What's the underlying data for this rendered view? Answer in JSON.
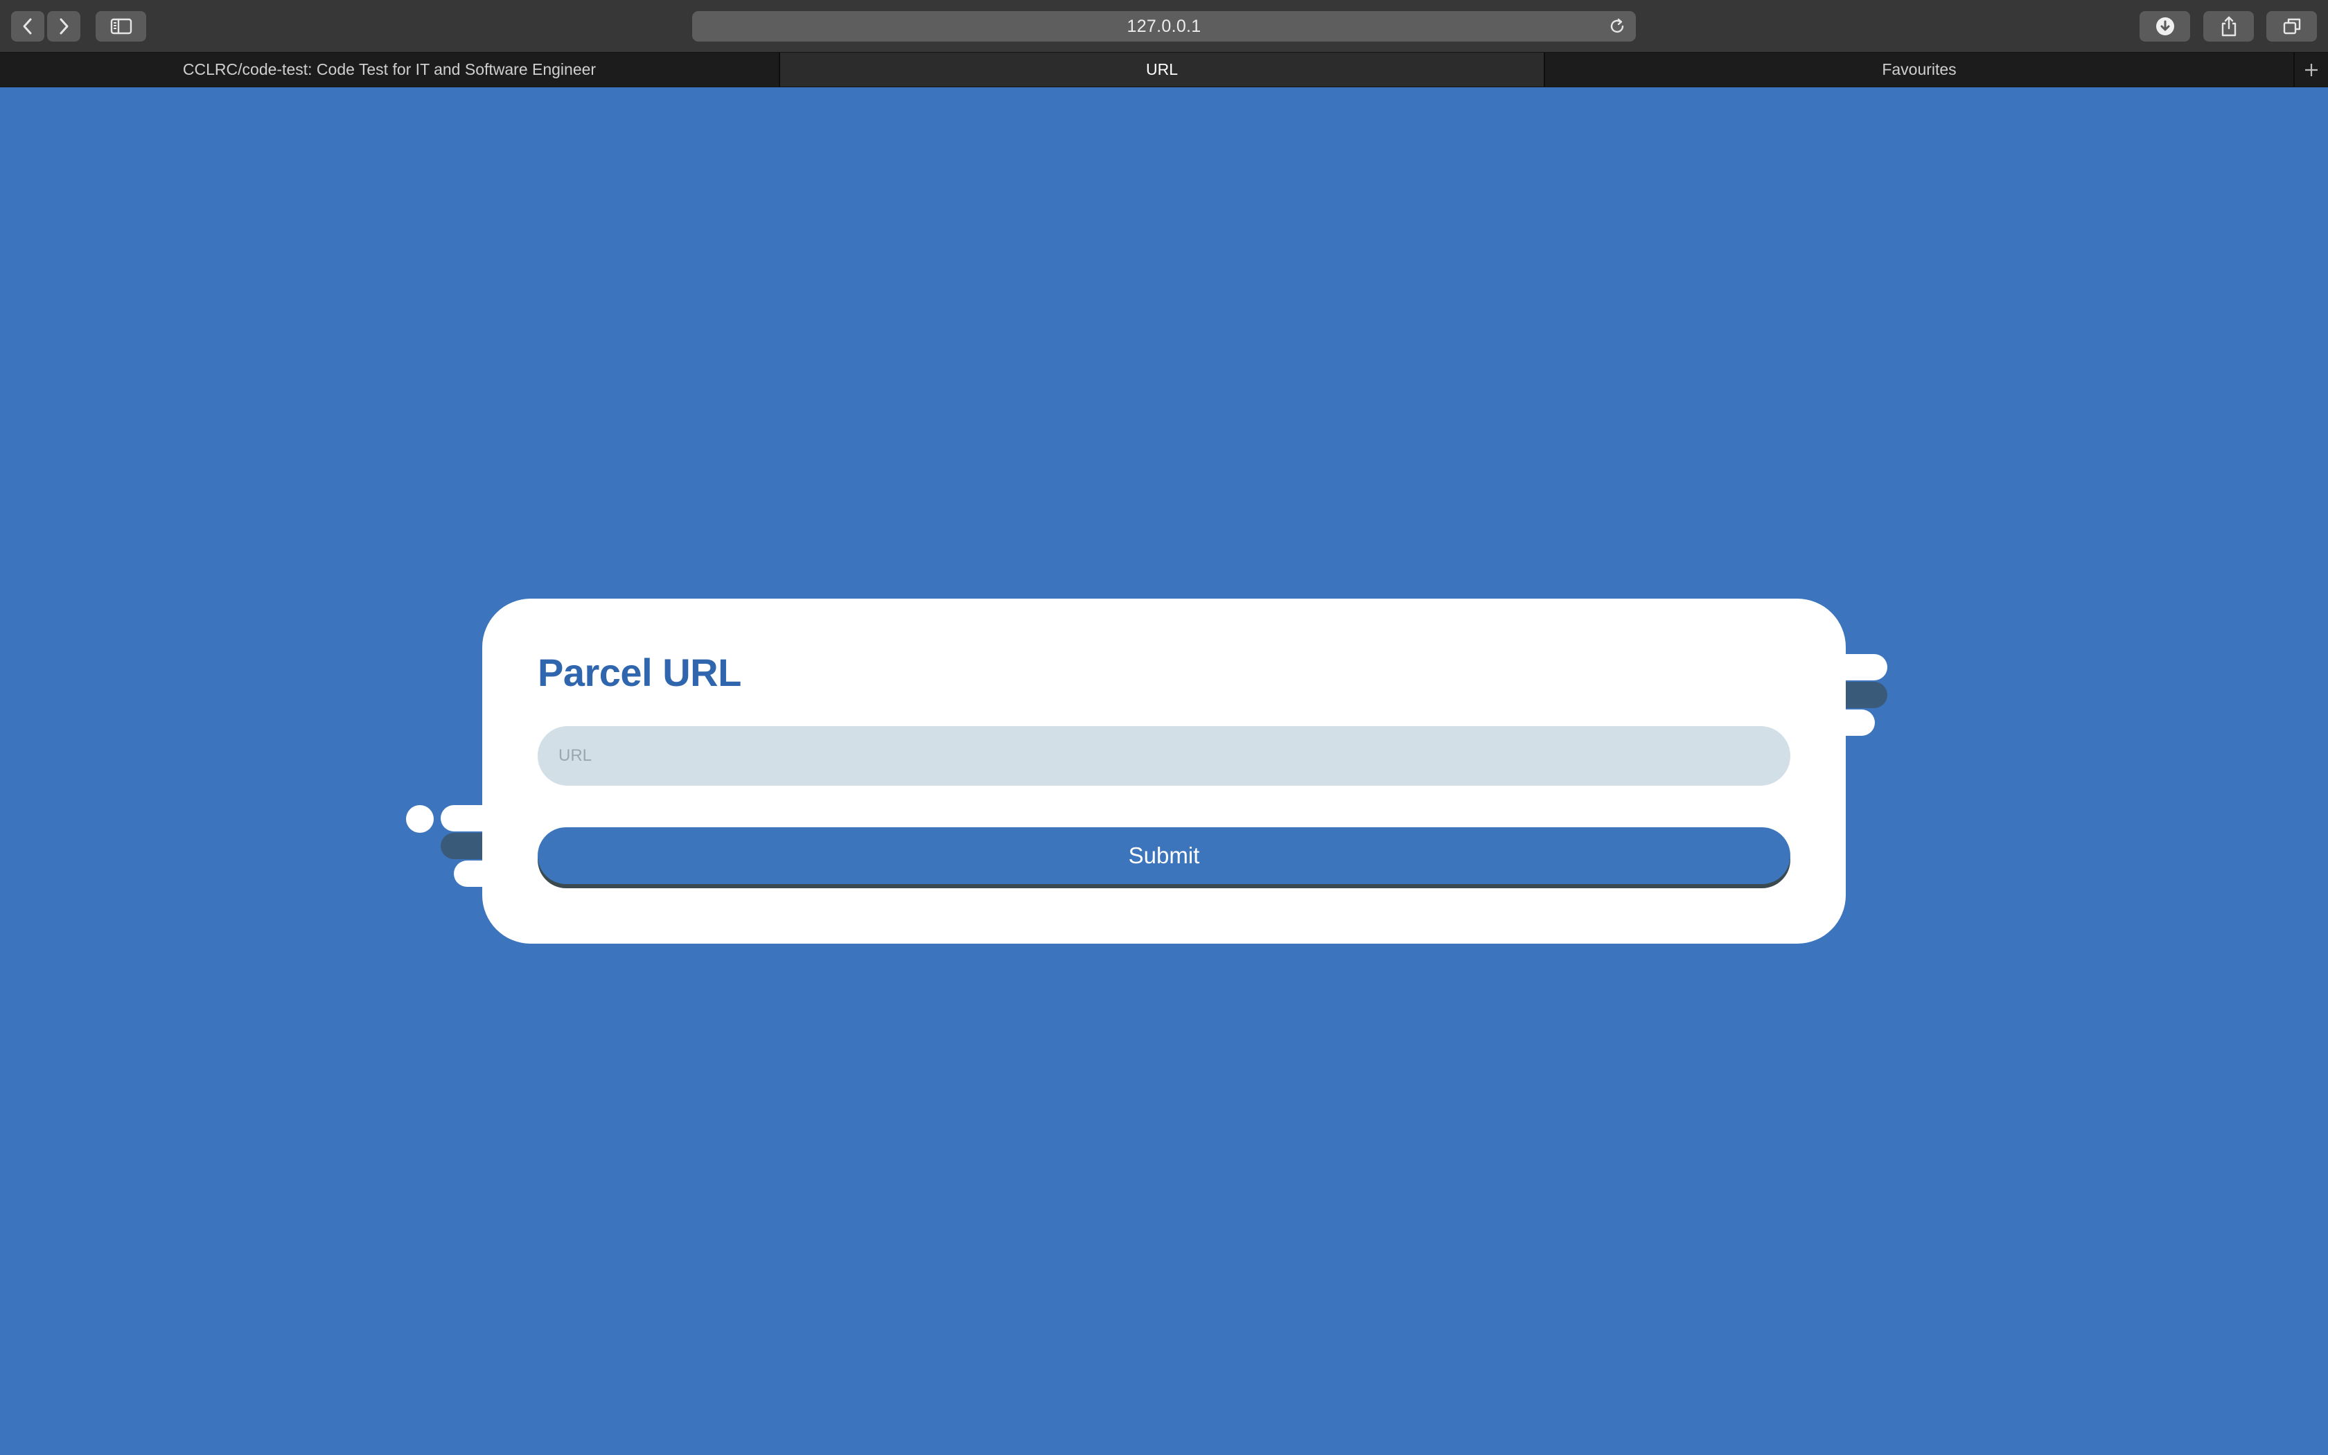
{
  "browser": {
    "address": "127.0.0.1",
    "tabs": [
      {
        "label": "CCLRC/code-test: Code Test for IT and Software Engineer",
        "active": false
      },
      {
        "label": "URL",
        "active": true
      },
      {
        "label": "Favourites",
        "active": false
      }
    ],
    "icons": {
      "back": "chevron-left-icon",
      "forward": "chevron-right-icon",
      "sidebar": "sidebar-icon",
      "reload": "reload-icon",
      "downloads": "download-icon",
      "share": "share-icon",
      "tabs_overview": "tabs-overview-icon",
      "new_tab": "plus-icon"
    }
  },
  "form": {
    "title": "Parcel URL",
    "url_placeholder": "URL",
    "url_value": "",
    "submit_label": "Submit"
  },
  "colors": {
    "page_background": "#3c75bd",
    "card_background": "#ffffff",
    "title": "#2f66ad",
    "input_background": "#d3dfe6",
    "button": "#3d75bd",
    "button_shadow": "#3a4a4e",
    "decor_dark": "#3a5a7a"
  }
}
